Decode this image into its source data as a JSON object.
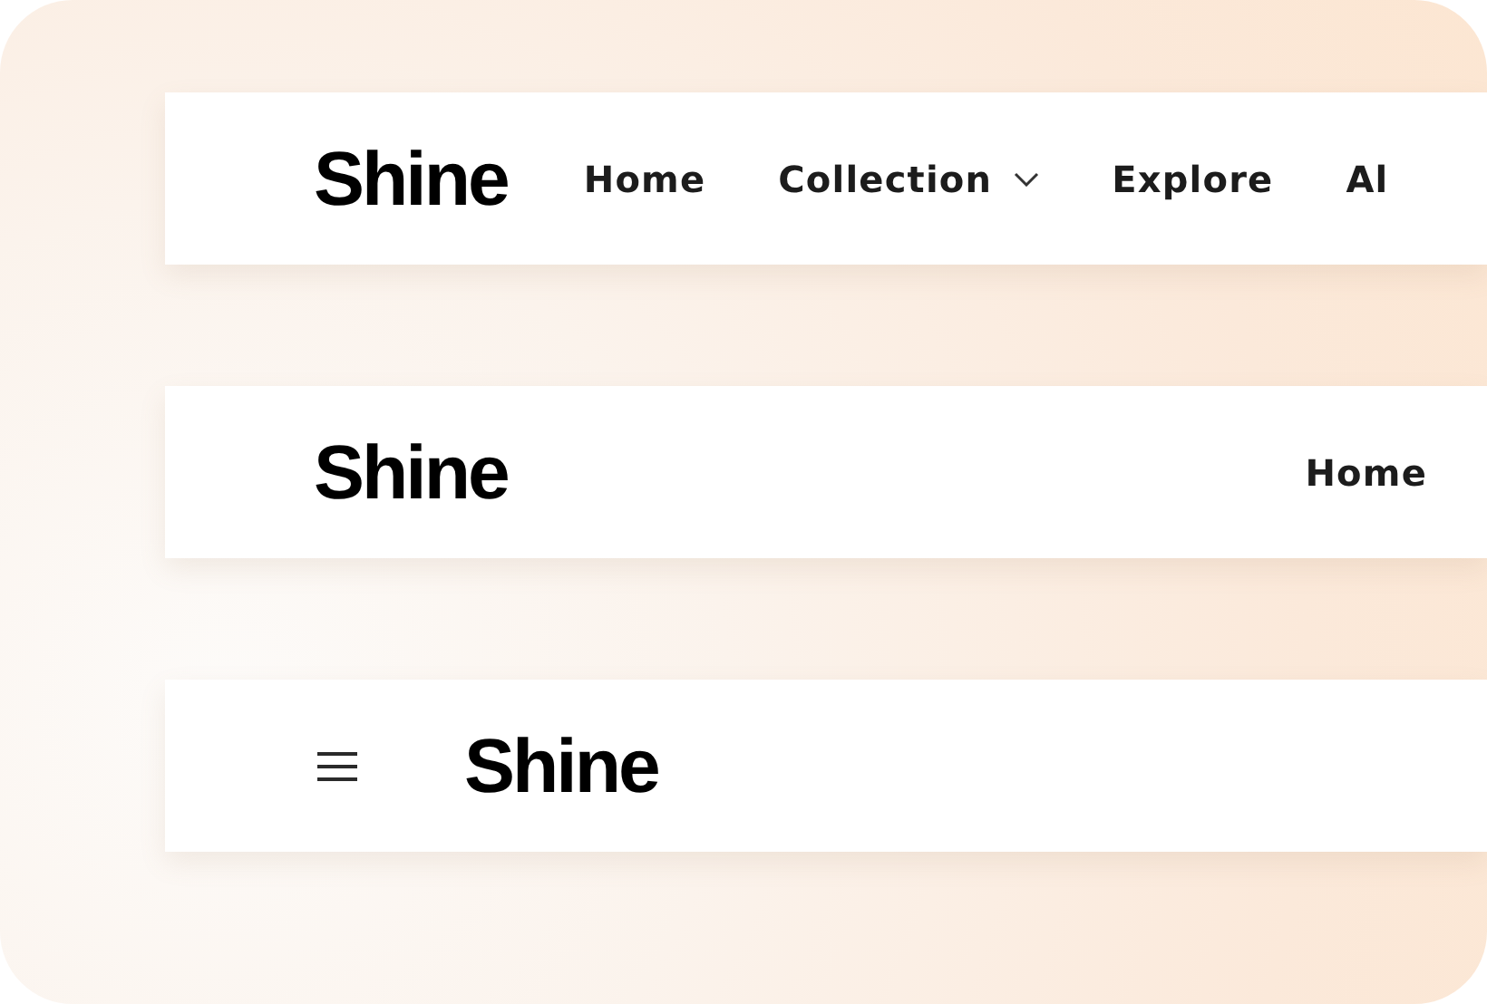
{
  "navbars": [
    {
      "kind": "full",
      "logo": "Shine",
      "links": [
        {
          "label": "Home",
          "dropdown": false
        },
        {
          "label": "Collection",
          "dropdown": true
        },
        {
          "label": "Explore",
          "dropdown": false
        },
        {
          "label": "Al",
          "dropdown": false
        }
      ]
    },
    {
      "kind": "compact",
      "logo": "Shine",
      "links": [
        {
          "label": "Home",
          "dropdown": false
        }
      ]
    },
    {
      "kind": "mobile",
      "logo": "Shine"
    }
  ]
}
